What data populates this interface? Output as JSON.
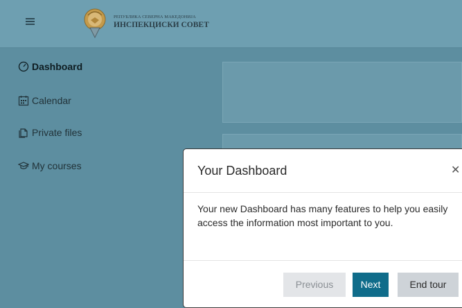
{
  "header": {
    "menu_icon": "hamburger-icon",
    "logo_icon": "coat-of-arms-icon",
    "brand_small": "РЕПУБЛИКА СЕВЕРНА МАКЕДОНИЈА",
    "brand_big": "ИНСПЕКЦИСКИ СОВЕТ"
  },
  "sidebar": {
    "items": [
      {
        "label": "Dashboard",
        "icon": "dashboard-gauge-icon",
        "active": true
      },
      {
        "label": "Calendar",
        "icon": "calendar-icon",
        "active": false
      },
      {
        "label": "Private files",
        "icon": "files-icon",
        "active": false
      },
      {
        "label": "My courses",
        "icon": "graduation-cap-icon",
        "active": false
      }
    ]
  },
  "tour": {
    "title": "Your Dashboard",
    "close_icon": "close-icon",
    "body": "Your new Dashboard has many features to help you easily access the information most important to you.",
    "buttons": {
      "previous": "Previous",
      "next": "Next",
      "end": "End tour"
    }
  },
  "colors": {
    "accent": "#0f6c8a",
    "backdrop": "#5d8ea0"
  }
}
